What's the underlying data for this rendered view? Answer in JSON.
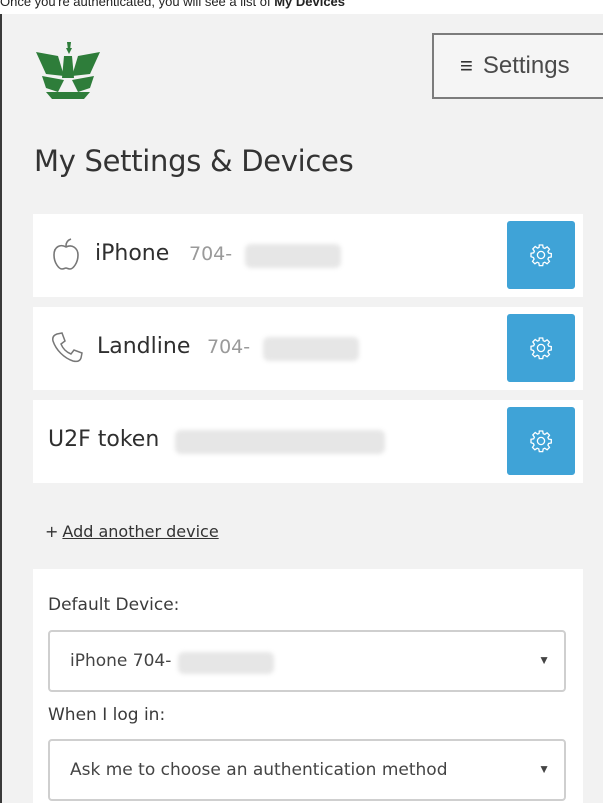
{
  "caption": {
    "text": "Once you're authenticated, you will see a list of ",
    "bold": "My Devices"
  },
  "header": {
    "settings_icon": "hamburger-icon",
    "settings_label": "Settings"
  },
  "page": {
    "title": "My Settings & Devices"
  },
  "devices": [
    {
      "icon": "apple-icon",
      "name": "iPhone",
      "number": "704-"
    },
    {
      "icon": "phone-icon",
      "name": "Landline",
      "number": "704-"
    },
    {
      "icon": "",
      "name": "U2F token",
      "number": ""
    }
  ],
  "add_device": {
    "plus": "+",
    "label": "Add another device"
  },
  "preferences": {
    "default_device_label": "Default Device:",
    "default_device_value": "iPhone 704-",
    "login_label": "When I log in:",
    "login_value": "Ask me to choose an authentication method",
    "dropdown_arrow": "▼"
  },
  "colors": {
    "accent": "#3fa3d7",
    "logo_green": "#2e7d3a",
    "background": "#f2f2f2"
  }
}
